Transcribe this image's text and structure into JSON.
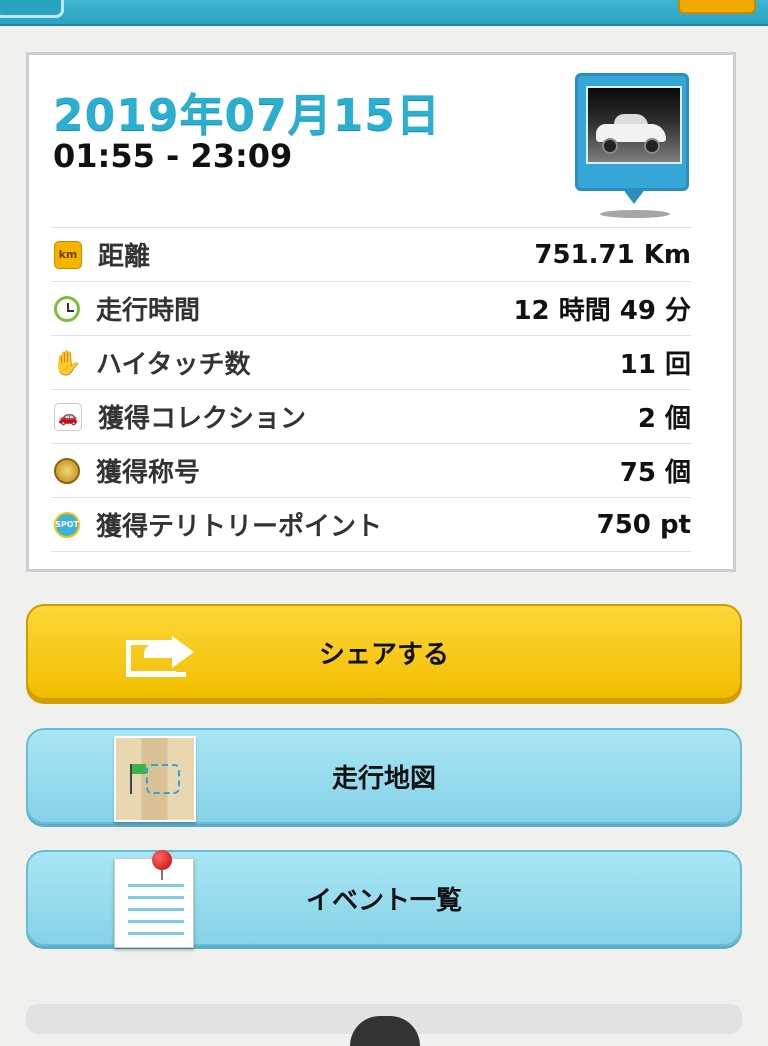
{
  "summary": {
    "date": "2019年07月15日",
    "time_range": "01:55 - 23:09"
  },
  "stats": [
    {
      "icon": "km-icon",
      "icon_text": "km",
      "label": "距離",
      "value": "751.71 Km"
    },
    {
      "icon": "clock-icon",
      "icon_text": "",
      "label": "走行時間",
      "value": "12 時間 49 分"
    },
    {
      "icon": "high-five-hand-icon",
      "icon_text": "✋",
      "label": "ハイタッチ数",
      "value": "11 回"
    },
    {
      "icon": "car-icon",
      "icon_text": "🚗",
      "label": "獲得コレクション",
      "value": "2 個"
    },
    {
      "icon": "medal-icon",
      "icon_text": "",
      "label": "獲得称号",
      "value": "75 個"
    },
    {
      "icon": "spot-icon",
      "icon_text": "SPOT",
      "label": "獲得テリトリーポイント",
      "value": "750 pt"
    }
  ],
  "buttons": {
    "share_label": "シェアする",
    "map_label": "走行地図",
    "event_label": "イベント一覧"
  },
  "colors": {
    "accent": "#2bafd1",
    "share_button": "#f6c800",
    "secondary_button": "#93d8ec"
  }
}
